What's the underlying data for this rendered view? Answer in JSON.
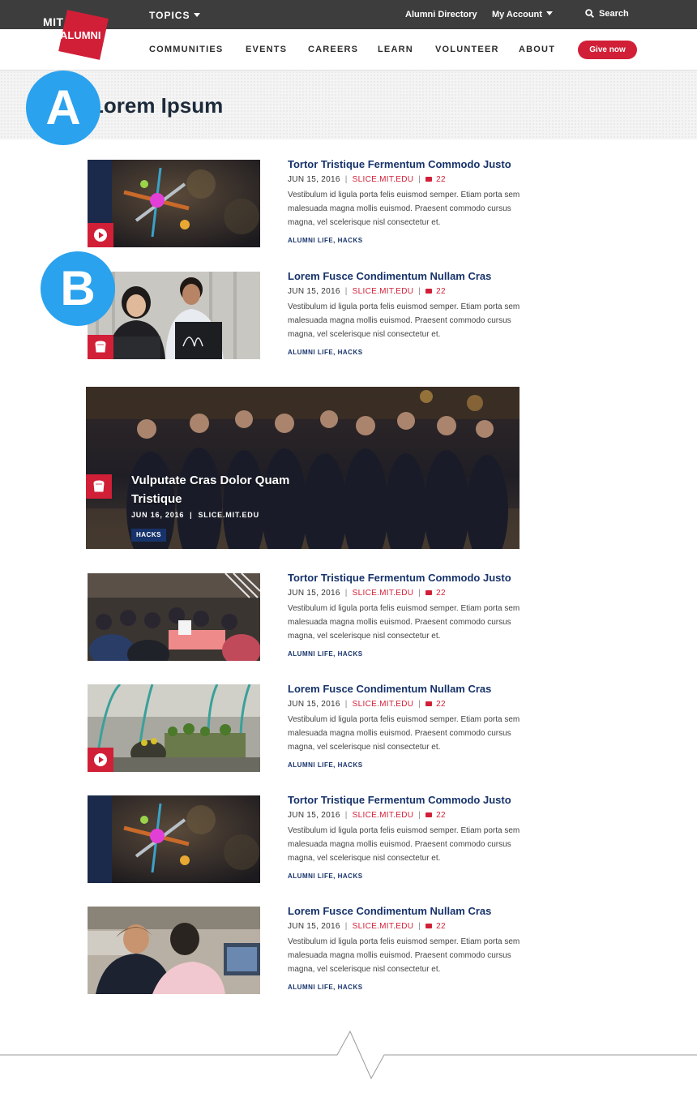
{
  "brand": {
    "mit": "MIT",
    "alumni": "ALUMNI"
  },
  "topbar": {
    "topics": "TOPICS",
    "alumni_directory": "Alumni Directory",
    "my_account": "My Account",
    "search": "Search"
  },
  "nav": {
    "items": [
      "COMMUNITIES",
      "EVENTS",
      "CAREERS",
      "LEARN",
      "VOLUNTEER",
      "ABOUT"
    ],
    "give_now": "Give now"
  },
  "hero": {
    "title": "Lorem Ipsum"
  },
  "annotations": {
    "a": "A",
    "b": "B"
  },
  "articles": [
    {
      "headline": "Tortor Tristique Fermentum Commodo Justo",
      "date": "JUN 15, 2016",
      "source": "SLICE.MIT.EDU",
      "comments": "22",
      "excerpt": "Vestibulum id ligula porta felis euismod semper. Etiam porta sem malesuada magna mollis euismod. Praesent commodo cursus magna, vel scelerisque nisl consectetur et.",
      "tags": "ALUMNI LIFE, HACKS",
      "media": "play-icon"
    },
    {
      "headline": "Lorem Fusce Condimentum Nullam Cras",
      "date": "JUN 15, 2016",
      "source": "SLICE.MIT.EDU",
      "comments": "22",
      "excerpt": "Vestibulum id ligula porta felis euismod semper. Etiam porta sem malesuada magna mollis euismod. Praesent commodo cursus magna, vel scelerisque nisl consectetur et.",
      "tags": "ALUMNI LIFE, HACKS",
      "media": "slice-icon"
    },
    {
      "headline": "Tortor Tristique Fermentum Commodo Justo",
      "date": "JUN 15, 2016",
      "source": "SLICE.MIT.EDU",
      "comments": "22",
      "excerpt": "Vestibulum id ligula porta felis euismod semper. Etiam porta sem malesuada magna mollis euismod. Praesent commodo cursus magna, vel scelerisque nisl consectetur et.",
      "tags": "ALUMNI LIFE, HACKS",
      "media": ""
    },
    {
      "headline": "Lorem Fusce Condimentum Nullam Cras",
      "date": "JUN 15, 2016",
      "source": "SLICE.MIT.EDU",
      "comments": "22",
      "excerpt": "Vestibulum id ligula porta felis euismod semper. Etiam porta sem malesuada magna mollis euismod. Praesent commodo cursus magna, vel scelerisque nisl consectetur et.",
      "tags": "ALUMNI LIFE, HACKS",
      "media": "play-icon"
    },
    {
      "headline": "Tortor Tristique Fermentum Commodo Justo",
      "date": "JUN 15, 2016",
      "source": "SLICE.MIT.EDU",
      "comments": "22",
      "excerpt": "Vestibulum id ligula porta felis euismod semper. Etiam porta sem malesuada magna mollis euismod. Praesent commodo cursus magna, vel scelerisque nisl consectetur et.",
      "tags": "ALUMNI LIFE, HACKS",
      "media": ""
    },
    {
      "headline": "Lorem Fusce Condimentum Nullam Cras",
      "date": "JUN 15, 2016",
      "source": "SLICE.MIT.EDU",
      "comments": "22",
      "excerpt": "Vestibulum id ligula porta felis euismod semper. Etiam porta sem malesuada magna mollis euismod. Praesent commodo cursus magna, vel scelerisque nisl consectetur et.",
      "tags": "ALUMNI LIFE, HACKS",
      "media": ""
    }
  ],
  "feature": {
    "title": "Vulputate Cras Dolor Quam Tristique",
    "date": "JUN 16, 2016",
    "source": "SLICE.MIT.EDU",
    "tag": "HACKS",
    "media": "slice-icon"
  },
  "colors": {
    "accent": "#d11f37",
    "navy": "#17336b",
    "topbar": "#3d3d3d",
    "badge": "#2aa2ee"
  }
}
